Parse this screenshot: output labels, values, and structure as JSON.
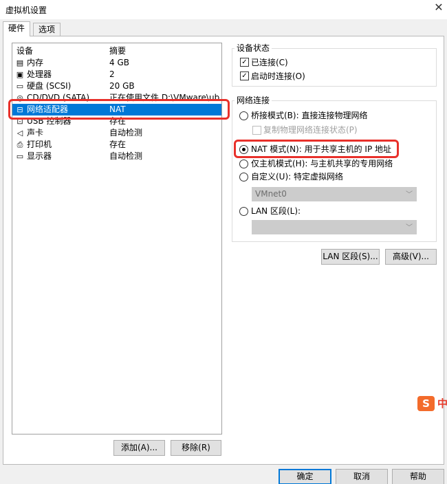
{
  "window": {
    "title": "虚拟机设置",
    "close_glyph": "✕"
  },
  "tabs": [
    {
      "label": "硬件",
      "active": true
    },
    {
      "label": "选项",
      "active": false
    }
  ],
  "device_list": {
    "header": {
      "device": "设备",
      "summary": "摘要"
    },
    "rows": [
      {
        "icon": "memory-icon",
        "name": "内存",
        "summary": "4 GB"
      },
      {
        "icon": "processor-icon",
        "name": "处理器",
        "summary": "2"
      },
      {
        "icon": "harddisk-icon",
        "name": "硬盘 (SCSI)",
        "summary": "20 GB"
      },
      {
        "icon": "cdrom-icon",
        "name": "CD/DVD (SATA)",
        "summary": "正在使用文件 D:\\VMware\\ub..."
      },
      {
        "icon": "network-adapter-icon",
        "name": "网络适配器",
        "summary": "NAT",
        "selected": true
      },
      {
        "icon": "usb-icon",
        "name": "USB 控制器",
        "summary": "存在"
      },
      {
        "icon": "sound-icon",
        "name": "声卡",
        "summary": "自动检测"
      },
      {
        "icon": "printer-icon",
        "name": "打印机",
        "summary": "存在"
      },
      {
        "icon": "display-icon",
        "name": "显示器",
        "summary": "自动检测"
      }
    ]
  },
  "list_buttons": {
    "add": "添加(A)...",
    "remove": "移除(R)"
  },
  "device_status": {
    "label": "设备状态",
    "connected": {
      "label": "已连接(C)",
      "checked": true
    },
    "connect_at_power_on": {
      "label": "启动时连接(O)",
      "checked": true
    }
  },
  "network_connection": {
    "label": "网络连接",
    "bridged": {
      "label": "桥接模式(B): 直接连接物理网络",
      "selected": false
    },
    "replicate": {
      "label": "复制物理网络连接状态(P)",
      "checked": false,
      "enabled": false
    },
    "nat": {
      "label": "NAT 模式(N): 用于共享主机的 IP 地址",
      "selected": true
    },
    "host_only": {
      "label": "仅主机模式(H): 与主机共享的专用网络",
      "selected": false
    },
    "custom": {
      "label": "自定义(U): 特定虚拟网络",
      "selected": false
    },
    "custom_select_value": "VMnet0",
    "lan_segment": {
      "label": "LAN 区段(L):",
      "selected": false
    },
    "lan_select_value": ""
  },
  "net_buttons": {
    "lan_segments": "LAN 区段(S)...",
    "advanced": "高级(V)..."
  },
  "footer_buttons": {
    "ok": "确定",
    "cancel": "取消",
    "help": "帮助"
  },
  "ime": {
    "logo": "S",
    "mode": "中"
  },
  "colors": {
    "selection": "#0078d7",
    "highlight_box": "#e8302a",
    "ime": "#f36b2b"
  }
}
